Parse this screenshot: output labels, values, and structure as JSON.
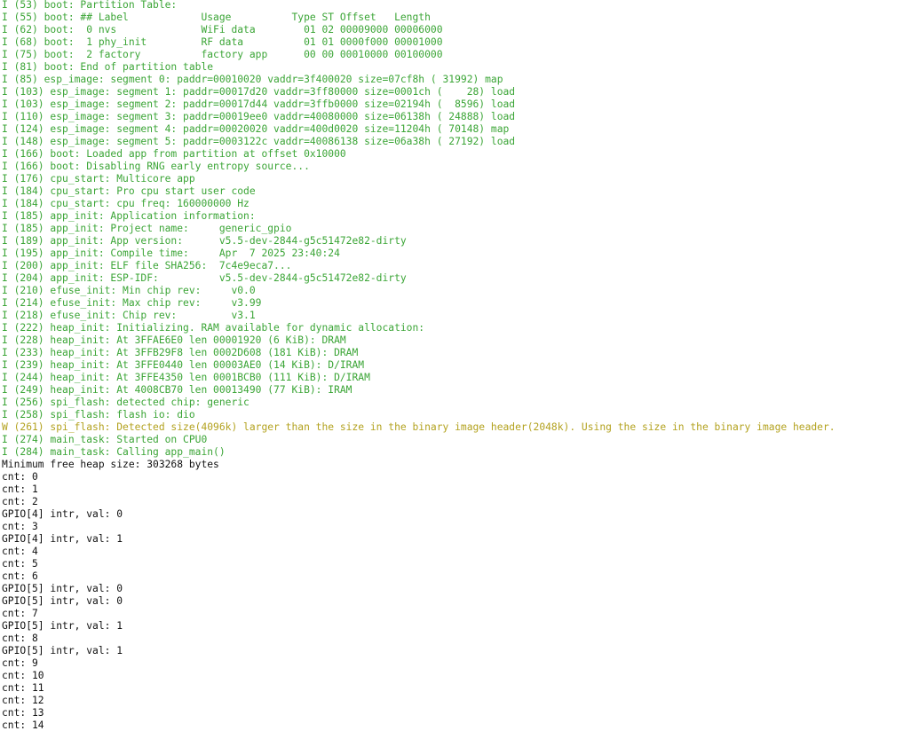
{
  "colors": {
    "info": "#3ba536",
    "warning": "#b3a21f",
    "plain": "#111111",
    "background": "#ffffff"
  },
  "lines": [
    {
      "level": "I",
      "text": "I (53) boot: Partition Table:"
    },
    {
      "level": "I",
      "text": "I (55) boot: ## Label            Usage          Type ST Offset   Length"
    },
    {
      "level": "I",
      "text": "I (62) boot:  0 nvs              WiFi data        01 02 00009000 00006000"
    },
    {
      "level": "I",
      "text": "I (68) boot:  1 phy_init         RF data          01 01 0000f000 00001000"
    },
    {
      "level": "I",
      "text": "I (75) boot:  2 factory          factory app      00 00 00010000 00100000"
    },
    {
      "level": "I",
      "text": "I (81) boot: End of partition table"
    },
    {
      "level": "I",
      "text": "I (85) esp_image: segment 0: paddr=00010020 vaddr=3f400020 size=07cf8h ( 31992) map"
    },
    {
      "level": "I",
      "text": "I (103) esp_image: segment 1: paddr=00017d20 vaddr=3ff80000 size=0001ch (    28) load"
    },
    {
      "level": "I",
      "text": "I (103) esp_image: segment 2: paddr=00017d44 vaddr=3ffb0000 size=02194h (  8596) load"
    },
    {
      "level": "I",
      "text": "I (110) esp_image: segment 3: paddr=00019ee0 vaddr=40080000 size=06138h ( 24888) load"
    },
    {
      "level": "I",
      "text": "I (124) esp_image: segment 4: paddr=00020020 vaddr=400d0020 size=11204h ( 70148) map"
    },
    {
      "level": "I",
      "text": "I (148) esp_image: segment 5: paddr=0003122c vaddr=40086138 size=06a38h ( 27192) load"
    },
    {
      "level": "I",
      "text": "I (166) boot: Loaded app from partition at offset 0x10000"
    },
    {
      "level": "I",
      "text": "I (166) boot: Disabling RNG early entropy source..."
    },
    {
      "level": "I",
      "text": "I (176) cpu_start: Multicore app"
    },
    {
      "level": "I",
      "text": "I (184) cpu_start: Pro cpu start user code"
    },
    {
      "level": "I",
      "text": "I (184) cpu_start: cpu freq: 160000000 Hz"
    },
    {
      "level": "I",
      "text": "I (185) app_init: Application information:"
    },
    {
      "level": "I",
      "text": "I (185) app_init: Project name:     generic_gpio"
    },
    {
      "level": "I",
      "text": "I (189) app_init: App version:      v5.5-dev-2844-g5c51472e82-dirty"
    },
    {
      "level": "I",
      "text": "I (195) app_init: Compile time:     Apr  7 2025 23:40:24"
    },
    {
      "level": "I",
      "text": "I (200) app_init: ELF file SHA256:  7c4e9eca7..."
    },
    {
      "level": "I",
      "text": "I (204) app_init: ESP-IDF:          v5.5-dev-2844-g5c51472e82-dirty"
    },
    {
      "level": "I",
      "text": "I (210) efuse_init: Min chip rev:     v0.0"
    },
    {
      "level": "I",
      "text": "I (214) efuse_init: Max chip rev:     v3.99"
    },
    {
      "level": "I",
      "text": "I (218) efuse_init: Chip rev:         v3.1"
    },
    {
      "level": "I",
      "text": "I (222) heap_init: Initializing. RAM available for dynamic allocation:"
    },
    {
      "level": "I",
      "text": "I (228) heap_init: At 3FFAE6E0 len 00001920 (6 KiB): DRAM"
    },
    {
      "level": "I",
      "text": "I (233) heap_init: At 3FFB29F8 len 0002D608 (181 KiB): DRAM"
    },
    {
      "level": "I",
      "text": "I (239) heap_init: At 3FFE0440 len 00003AE0 (14 KiB): D/IRAM"
    },
    {
      "level": "I",
      "text": "I (244) heap_init: At 3FFE4350 len 0001BCB0 (111 KiB): D/IRAM"
    },
    {
      "level": "I",
      "text": "I (249) heap_init: At 4008CB70 len 00013490 (77 KiB): IRAM"
    },
    {
      "level": "I",
      "text": "I (256) spi_flash: detected chip: generic"
    },
    {
      "level": "I",
      "text": "I (258) spi_flash: flash io: dio"
    },
    {
      "level": "W",
      "text": "W (261) spi_flash: Detected size(4096k) larger than the size in the binary image header(2048k). Using the size in the binary image header."
    },
    {
      "level": "I",
      "text": "I (274) main_task: Started on CPU0"
    },
    {
      "level": "I",
      "text": "I (284) main_task: Calling app_main()"
    },
    {
      "level": "N",
      "text": "Minimum free heap size: 303268 bytes"
    },
    {
      "level": "N",
      "text": "cnt: 0"
    },
    {
      "level": "N",
      "text": "cnt: 1"
    },
    {
      "level": "N",
      "text": "cnt: 2"
    },
    {
      "level": "N",
      "text": "GPIO[4] intr, val: 0"
    },
    {
      "level": "N",
      "text": "cnt: 3"
    },
    {
      "level": "N",
      "text": "GPIO[4] intr, val: 1"
    },
    {
      "level": "N",
      "text": "cnt: 4"
    },
    {
      "level": "N",
      "text": "cnt: 5"
    },
    {
      "level": "N",
      "text": "cnt: 6"
    },
    {
      "level": "N",
      "text": "GPIO[5] intr, val: 0"
    },
    {
      "level": "N",
      "text": "GPIO[5] intr, val: 0"
    },
    {
      "level": "N",
      "text": "cnt: 7"
    },
    {
      "level": "N",
      "text": "GPIO[5] intr, val: 1"
    },
    {
      "level": "N",
      "text": "cnt: 8"
    },
    {
      "level": "N",
      "text": "GPIO[5] intr, val: 1"
    },
    {
      "level": "N",
      "text": "cnt: 9"
    },
    {
      "level": "N",
      "text": "cnt: 10"
    },
    {
      "level": "N",
      "text": "cnt: 11"
    },
    {
      "level": "N",
      "text": "cnt: 12"
    },
    {
      "level": "N",
      "text": "cnt: 13"
    },
    {
      "level": "N",
      "text": "cnt: 14"
    }
  ]
}
